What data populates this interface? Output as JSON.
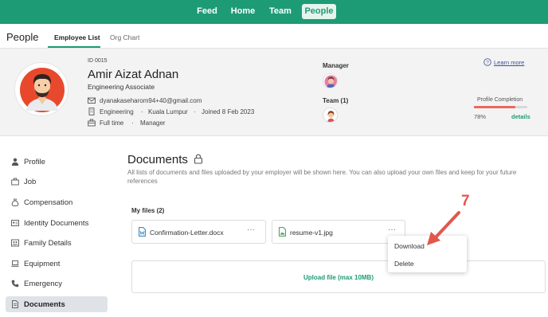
{
  "topnav": {
    "items": [
      {
        "label": "Feed"
      },
      {
        "label": "Home"
      },
      {
        "label": "Team"
      },
      {
        "label": "People"
      }
    ]
  },
  "subnav": {
    "title": "People",
    "tabs": [
      {
        "label": "Employee List"
      },
      {
        "label": "Org Chart"
      }
    ]
  },
  "profile": {
    "id": "ID 0015",
    "name": "Amir Aizat Adnan",
    "role": "Engineering Associate",
    "email": "dyanakaseharom94+40@gmail.com",
    "department": "Engineering",
    "location": "Kuala Lumpur",
    "joined": "Joined 8 Feb 2023",
    "employment_type": "Full time",
    "job_level": "Manager",
    "manager_label": "Manager",
    "team_label": "Team (1)",
    "learn_more": "Learn more",
    "completion_label": "Profile Completion",
    "completion_value": "78%",
    "completion_fraction": 0.78,
    "details_link": "details",
    "accent": "#1d9b75",
    "bar_color": "#e86a5f"
  },
  "sidebar": {
    "items": [
      {
        "label": "Profile",
        "icon": "person-icon"
      },
      {
        "label": "Job",
        "icon": "briefcase-icon"
      },
      {
        "label": "Compensation",
        "icon": "money-bag-icon"
      },
      {
        "label": "Identity Documents",
        "icon": "id-card-icon"
      },
      {
        "label": "Family Details",
        "icon": "family-icon"
      },
      {
        "label": "Equipment",
        "icon": "laptop-icon"
      },
      {
        "label": "Emergency",
        "icon": "phone-icon"
      },
      {
        "label": "Documents",
        "icon": "document-icon"
      }
    ]
  },
  "documents": {
    "title": "Documents",
    "description_line1": "All lists of documents and files uploaded by your employer will be shown here. You can also upload your own files and keep for your future",
    "description_line2": "references",
    "my_files_label": "My files (2)",
    "files": [
      {
        "name": "Confirmation-Letter.docx",
        "icon": "word-file-icon",
        "more": "···"
      },
      {
        "name": "resume-v1.jpg",
        "icon": "image-file-icon",
        "more": "···"
      }
    ],
    "menu": {
      "download": "Download",
      "delete": "Delete"
    },
    "upload_label": "Upload file (max 10MB)"
  },
  "annotation": {
    "number": "7",
    "color": "#e2574c"
  }
}
